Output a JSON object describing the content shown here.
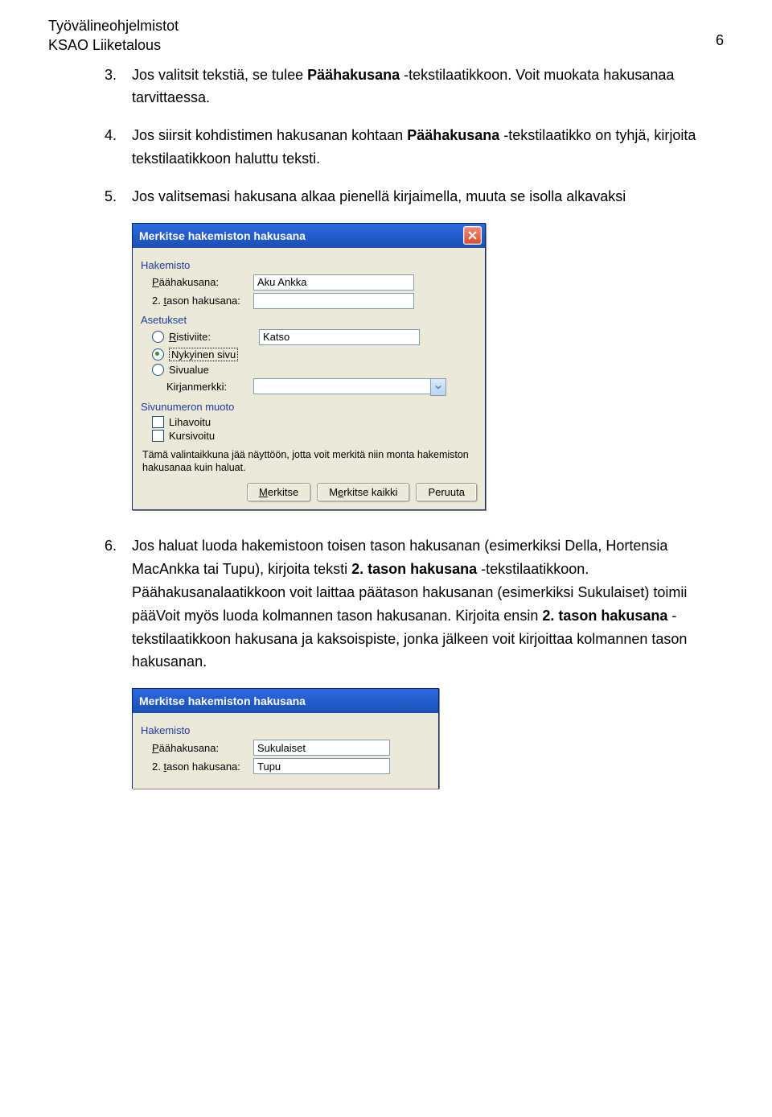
{
  "header": {
    "line1": "Työvälineohjelmistot",
    "line2": "KSAO Liiketalous",
    "page_number": "6"
  },
  "items": [
    {
      "num": "3.",
      "text_before": "Jos valitsit tekstiä, se tulee ",
      "bold": "Päähakusana",
      "text_after": "  -tekstilaatikkoon. Voit muokata hakusanaa tarvittaessa."
    },
    {
      "num": "4.",
      "text_before": "Jos siirsit kohdistimen hakusanan kohtaan ",
      "bold": "Päähakusana",
      "text_after": "  -tekstilaatikko on tyhjä, kirjoita tekstilaatikkoon haluttu teksti."
    },
    {
      "num": "5.",
      "text_before": "Jos valitsemasi hakusana alkaa pienellä kirjaimella, muuta se isolla alkavaksi",
      "bold": "",
      "text_after": ""
    }
  ],
  "dialog": {
    "title": "Merkitse hakemiston hakusana",
    "section_hakemisto": "Hakemisto",
    "label_paahakusana": "Päähakusana:",
    "value_paahakusana": "Aku Ankka",
    "label_tason2": "2. tason hakusana:",
    "value_tason2": "",
    "section_asetukset": "Asetukset",
    "radio_ristiviite": "Ristiviite:",
    "value_ristiviite": "Katso",
    "radio_nykyinen": "Nykyinen sivu",
    "radio_sivualue": "Sivualue",
    "label_kirjanmerkki": "Kirjanmerkki:",
    "section_sivunumero": "Sivunumeron muoto",
    "cb_lihavoitu": "Lihavoitu",
    "cb_kursivoitu": "Kursivoitu",
    "info": "Tämä valintaikkuna jää näyttöön, jotta voit merkitä niin monta hakemiston hakusanaa kuin haluat.",
    "btn_merkitse": "Merkitse",
    "btn_merkitse_kaikki": "Merkitse kaikki",
    "btn_peruuta": "Peruuta"
  },
  "item6": {
    "num": "6.",
    "p1a": "Jos haluat luoda hakemistoon toisen tason hakusanan (esimerkiksi Della, Hortensia MacAnkka tai Tupu), kirjoita teksti ",
    "p1b": "2. tason hakusana",
    "p1c": " -tekstilaatikkoon. Päähakusanalaatikkoon voit laittaa päätason hakusanan (esimerkiksi Sukulaiset) toimii pääVoit myös luoda kolmannen tason hakusanan. Kirjoita ensin ",
    "p1d": "2. tason hakusana",
    "p1e": " -tekstilaatikkoon hakusana ja kaksoispiste, jonka jälkeen voit kirjoittaa kolmannen tason hakusanan."
  },
  "dialog2": {
    "title": "Merkitse hakemiston hakusana",
    "section_hakemisto": "Hakemisto",
    "label_paahakusana": "Päähakusana:",
    "value_paahakusana": "Sukulaiset",
    "label_tason2": "2. tason hakusana:",
    "value_tason2": "Tupu"
  }
}
